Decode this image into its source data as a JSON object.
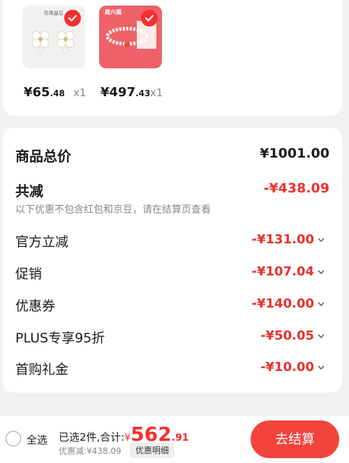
{
  "products": [
    {
      "brand": "珍珠皇后",
      "price_int": "¥65",
      "price_dec": ".48",
      "qty": "x1"
    },
    {
      "brand": "周六福",
      "price_int": "¥497",
      "price_dec": ".43",
      "qty": "x1"
    }
  ],
  "summary": {
    "total_label": "商品总价",
    "total_value": "¥1001.00",
    "reduce_label": "共减",
    "reduce_value": "-¥438.09",
    "note": "以下优惠不包含红包和京豆，请在结算页查看",
    "items": [
      {
        "label": "官方立减",
        "value": "-¥131.00"
      },
      {
        "label": "促销",
        "value": "-¥107.04"
      },
      {
        "label": "优惠券",
        "value": "-¥140.00"
      },
      {
        "label": "PLUS专享95折",
        "value": "-¥50.05"
      },
      {
        "label": "首购礼金",
        "value": "-¥10.00"
      }
    ]
  },
  "bottom_bar": {
    "select_all": "全选",
    "selected_text": "已选2件,合计:",
    "currency": "¥",
    "total_int": "562",
    "total_dec": ".91",
    "discount_text": "优惠减:¥438.09",
    "detail_button": "优惠明细",
    "checkout_button": "去结算"
  },
  "colors": {
    "accent": "#f23030",
    "button": "#f2433c"
  },
  "icons": [
    "check-icon",
    "chevron-down-icon",
    "radio-icon"
  ]
}
